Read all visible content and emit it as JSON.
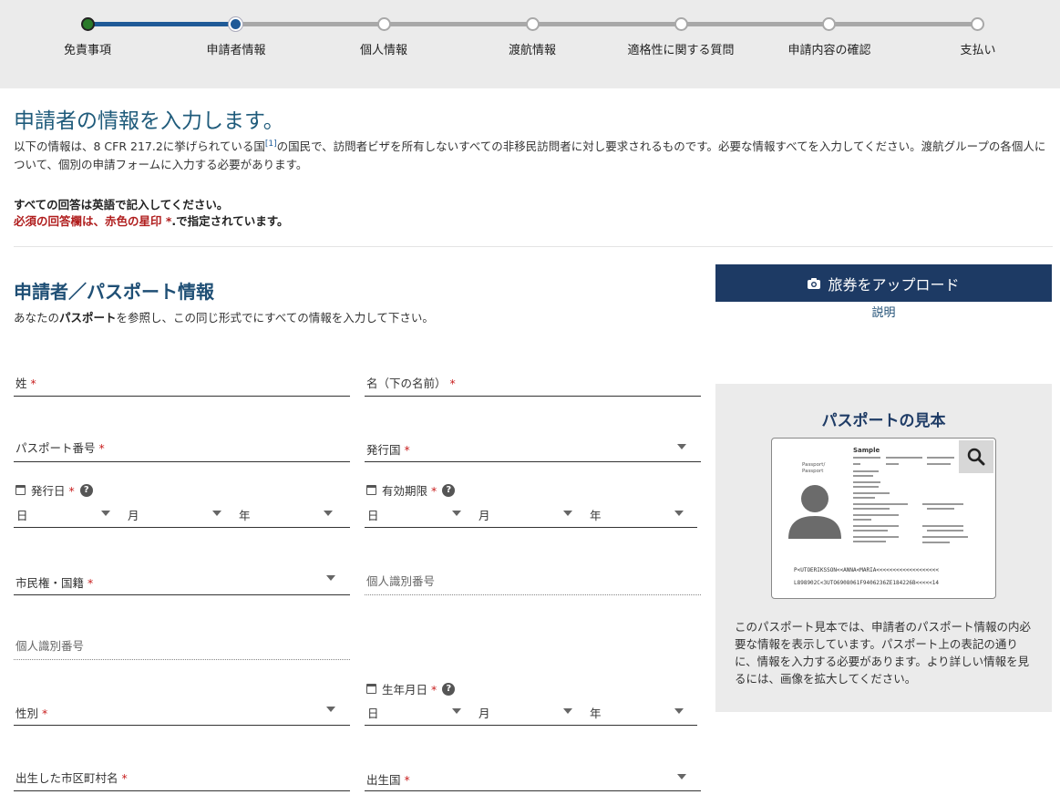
{
  "progress": {
    "steps": [
      {
        "label": "免責事項",
        "state": "done"
      },
      {
        "label": "申請者情報",
        "state": "current"
      },
      {
        "label": "個人情報",
        "state": "todo"
      },
      {
        "label": "渡航情報",
        "state": "todo"
      },
      {
        "label": "適格性に関する質問",
        "state": "todo"
      },
      {
        "label": "申請内容の確認",
        "state": "todo"
      },
      {
        "label": "支払い",
        "state": "todo"
      }
    ]
  },
  "intro": {
    "title": "申請者の情報を入力します。",
    "text_before": "以下の情報は、8 CFR 217.2に挙げられている国",
    "footnote": "[1]",
    "text_after": "の国民で、訪問者ビザを所有しないすべての非移民訪問者に対し要求されるものです。必要な情報すべてを入力してください。渡航グループの各個人について、個別の申請フォームに入力する必要があります。",
    "english_note": "すべての回答は英語で記入してください。",
    "required_note": "必須の回答欄は、赤色の星印 *",
    "required_note_rest": ".で指定されています。"
  },
  "section": {
    "title": "申請者／パスポート情報",
    "sub_before": "あなたの",
    "sub_bold": "パスポート",
    "sub_after": "を参照し、この同じ形式でにすべての情報を入力して下さい。"
  },
  "upload": {
    "button_label": "旅券をアップロード",
    "icon": "camera-icon",
    "explain_link": "説明"
  },
  "sample": {
    "title": "パスポートの見本",
    "description": "このパスポート見本では、申請者のパスポート情報の内必要な情報を表示しています。パスポート上の表記の通りに、情報を入力する必要があります。より詳しい情報を見るには、画像を拡大してください。",
    "image": {
      "sample_word": "Sample",
      "passport_word": "Passport/\nPassport",
      "mrz_line1": "P<UTOERIKSSON<<ANNA<MARIA<<<<<<<<<<<<<<<<<<<",
      "mrz_line2": "L898902C<3UTO6908061F9406236ZE184226B<<<<<14"
    }
  },
  "form": {
    "surname_label": "姓",
    "given_name_label": "名（下の名前）",
    "passport_number_label": "パスポート番号",
    "issuing_country_label": "発行国",
    "issue_date_label": "発行日",
    "expiry_date_label": "有効期限",
    "day_label": "日",
    "month_label": "月",
    "year_label": "年",
    "citizenship_label": "市民権・国籍",
    "national_id_label_1": "個人識別番号",
    "national_id_label_2": "個人識別番号",
    "sex_label": "性別",
    "birth_date_label": "生年月日",
    "birth_city_label": "出生した市区町村名",
    "birth_country_label": "出生国",
    "required_mark": "*",
    "help_mark": "?"
  }
}
